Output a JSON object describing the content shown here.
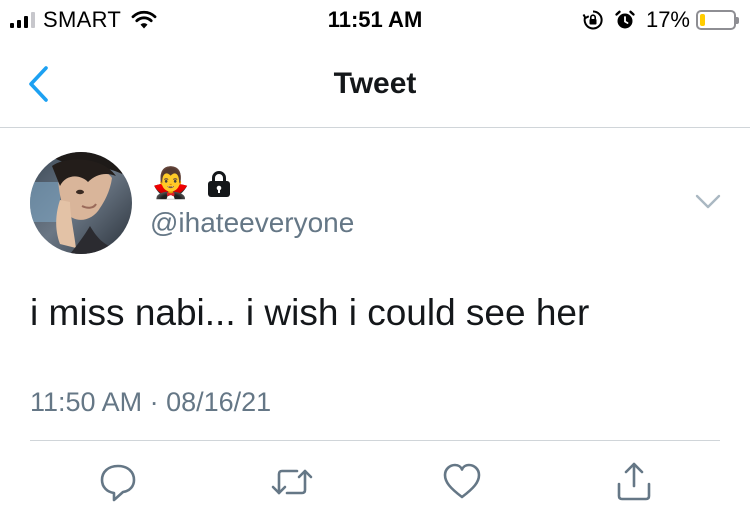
{
  "status_bar": {
    "carrier": "SMART",
    "time": "11:51 AM",
    "battery_percent": "17%",
    "battery_level": 0.17,
    "battery_color": "#ffcc00",
    "icons": [
      "cell-signal-icon",
      "wifi-icon",
      "orientation-lock-icon",
      "alarm-icon",
      "battery-icon"
    ]
  },
  "nav": {
    "title": "Tweet",
    "back_icon": "chevron-left-icon",
    "accent_color": "#1da1f2"
  },
  "tweet": {
    "display_name_emoji": "🧛‍♂️",
    "protected_icon": "lock-icon",
    "handle": "@ihateeveryone",
    "text": "i miss nabi... i wish i could see her",
    "timestamp": "11:50 AM · 08/16/21",
    "menu_icon": "chevron-down-icon"
  },
  "actions": [
    {
      "name": "reply",
      "icon": "reply-icon"
    },
    {
      "name": "retweet",
      "icon": "retweet-icon"
    },
    {
      "name": "like",
      "icon": "heart-icon"
    },
    {
      "name": "share",
      "icon": "share-icon"
    }
  ],
  "colors": {
    "text_primary": "#14171a",
    "text_secondary": "#657786",
    "divider": "#d0d5d9",
    "icon_gray": "#657786"
  }
}
